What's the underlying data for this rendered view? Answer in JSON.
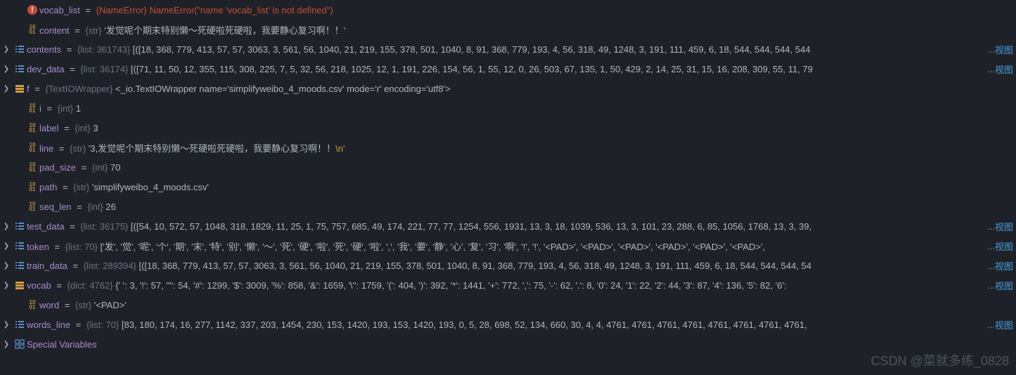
{
  "rows": [
    {
      "expandable": false,
      "iconType": "error",
      "indent": 1,
      "name": "vocab_list",
      "type": "{NameError}",
      "typeClass": "value-err",
      "value": "NameError(\"name 'vocab_list' is not defined\")",
      "valueClass": "value-err",
      "viewLink": false
    },
    {
      "expandable": false,
      "iconType": "bin",
      "indent": 1,
      "name": "content",
      "type": "{str}",
      "value": "'发觉呢个期末特别懒～死硬啦死硬啦，我要静心复习啊！！'",
      "viewLink": false
    },
    {
      "expandable": true,
      "iconType": "list",
      "indent": 0,
      "name": "contents",
      "type": "{list: 361743}",
      "value": "[([18, 368, 779, 413, 57, 57, 3063, 3, 561, 56, 1040, 21, 219, 155, 378, 501, 1040, 8, 91, 368, 779, 193, 4, 56, 318, 49, 1248, 3, 191, 111, 459, 6, 18, 544, 544, 544, 544",
      "viewLink": true
    },
    {
      "expandable": true,
      "iconType": "list",
      "indent": 0,
      "name": "dev_data",
      "type": "{list: 36174}",
      "value": "[([71, 11, 50, 12, 355, 115, 308, 225, 7, 5, 32, 56, 218, 1025, 12, 1, 191, 226, 154, 56, 1, 55, 12, 0, 26, 503, 67, 135, 1, 50, 429, 2, 14, 25, 31, 15, 16, 208, 309, 55, 11, 79",
      "viewLink": true
    },
    {
      "expandable": true,
      "iconType": "obj",
      "indent": 0,
      "name": "f",
      "type": "{TextIOWrapper}",
      "value": "<_io.TextIOWrapper name='simplifyweibo_4_moods.csv' mode='r' encoding='utf8'>",
      "viewLink": false
    },
    {
      "expandable": false,
      "iconType": "bin",
      "indent": 1,
      "name": "i",
      "type": "{int}",
      "value": "1",
      "viewLink": false
    },
    {
      "expandable": false,
      "iconType": "bin",
      "indent": 1,
      "name": "label",
      "type": "{int}",
      "value": "3",
      "viewLink": false
    },
    {
      "expandable": false,
      "iconType": "bin",
      "indent": 1,
      "name": "line",
      "type": "{str}",
      "value": "'3,发觉呢个期末特别懒～死硬啦死硬啦，我要静心复习啊！！",
      "suffix": "\\n'",
      "viewLink": false
    },
    {
      "expandable": false,
      "iconType": "bin",
      "indent": 1,
      "name": "pad_size",
      "type": "{int}",
      "value": "70",
      "viewLink": false
    },
    {
      "expandable": false,
      "iconType": "bin",
      "indent": 1,
      "name": "path",
      "type": "{str}",
      "value": "'simplifyweibo_4_moods.csv'",
      "viewLink": false
    },
    {
      "expandable": false,
      "iconType": "bin",
      "indent": 1,
      "name": "seq_len",
      "type": "{int}",
      "value": "26",
      "viewLink": false
    },
    {
      "expandable": true,
      "iconType": "list",
      "indent": 0,
      "name": "test_data",
      "type": "{list: 36175}",
      "value": "[([54, 10, 572, 57, 1048, 318, 1829, 11, 25, 1, 75, 757, 685, 49, 174, 221, 77, 77, 1254, 556, 1931, 13, 3, 18, 1039, 536, 13, 3, 101, 23, 288, 6, 85, 1056, 1768, 13, 3, 39,",
      "viewLink": true
    },
    {
      "expandable": true,
      "iconType": "list",
      "indent": 0,
      "name": "token",
      "type": "{list: 70}",
      "value": "['发', '觉', '呢', '个', '期', '末', '特', '别', '懒', '～', '死', '硬', '啦', '死', '硬', '啦', ',', '我', '要', '静', '心', '复', '习', '啊', '!', '!', '<PAD>', '<PAD>', '<PAD>', '<PAD>', '<PAD>', '<PAD>',",
      "viewLink": true
    },
    {
      "expandable": true,
      "iconType": "list",
      "indent": 0,
      "name": "train_data",
      "type": "{list: 289394}",
      "value": "[([18, 368, 779, 413, 57, 57, 3063, 3, 561, 56, 1040, 21, 219, 155, 378, 501, 1040, 8, 91, 368, 779, 193, 4, 56, 318, 49, 1248, 3, 191, 111, 459, 6, 18, 544, 544, 544, 54",
      "viewLink": true
    },
    {
      "expandable": true,
      "iconType": "dict",
      "indent": 0,
      "name": "vocab",
      "type": "{dict: 4762}",
      "value": "{' ': 3, '!': 57, '\"': 54, '#': 1299, '$': 3009, '%': 858, '&': 1659, '\\'': 1759, '(': 404, ')': 392, '*': 1441, '+': 772, ',': 75, '-': 62, '.': 8, '0': 24, '1': 22, '2': 44, '3': 87, '4': 136, '5': 82, '6':",
      "viewLink": true
    },
    {
      "expandable": false,
      "iconType": "bin",
      "indent": 1,
      "name": "word",
      "type": "{str}",
      "value": "'<PAD>'",
      "viewLink": false
    },
    {
      "expandable": true,
      "iconType": "list",
      "indent": 0,
      "name": "words_line",
      "type": "{list: 70}",
      "value": "[83, 180, 174, 16, 277, 1142, 337, 203, 1454, 230, 153, 1420, 193, 153, 1420, 193, 0, 5, 28, 698, 52, 134, 660, 30, 4, 4, 4761, 4761, 4761, 4761, 4761, 4761, 4761, 4761,",
      "viewLink": true
    },
    {
      "expandable": true,
      "iconType": "var",
      "indent": 0,
      "name": "Special Variables",
      "type": "",
      "value": "",
      "viewLink": false
    }
  ],
  "viewLinkLabel": "视图",
  "ellipsis": "...",
  "watermark": "CSDN @菜就多练_0828"
}
